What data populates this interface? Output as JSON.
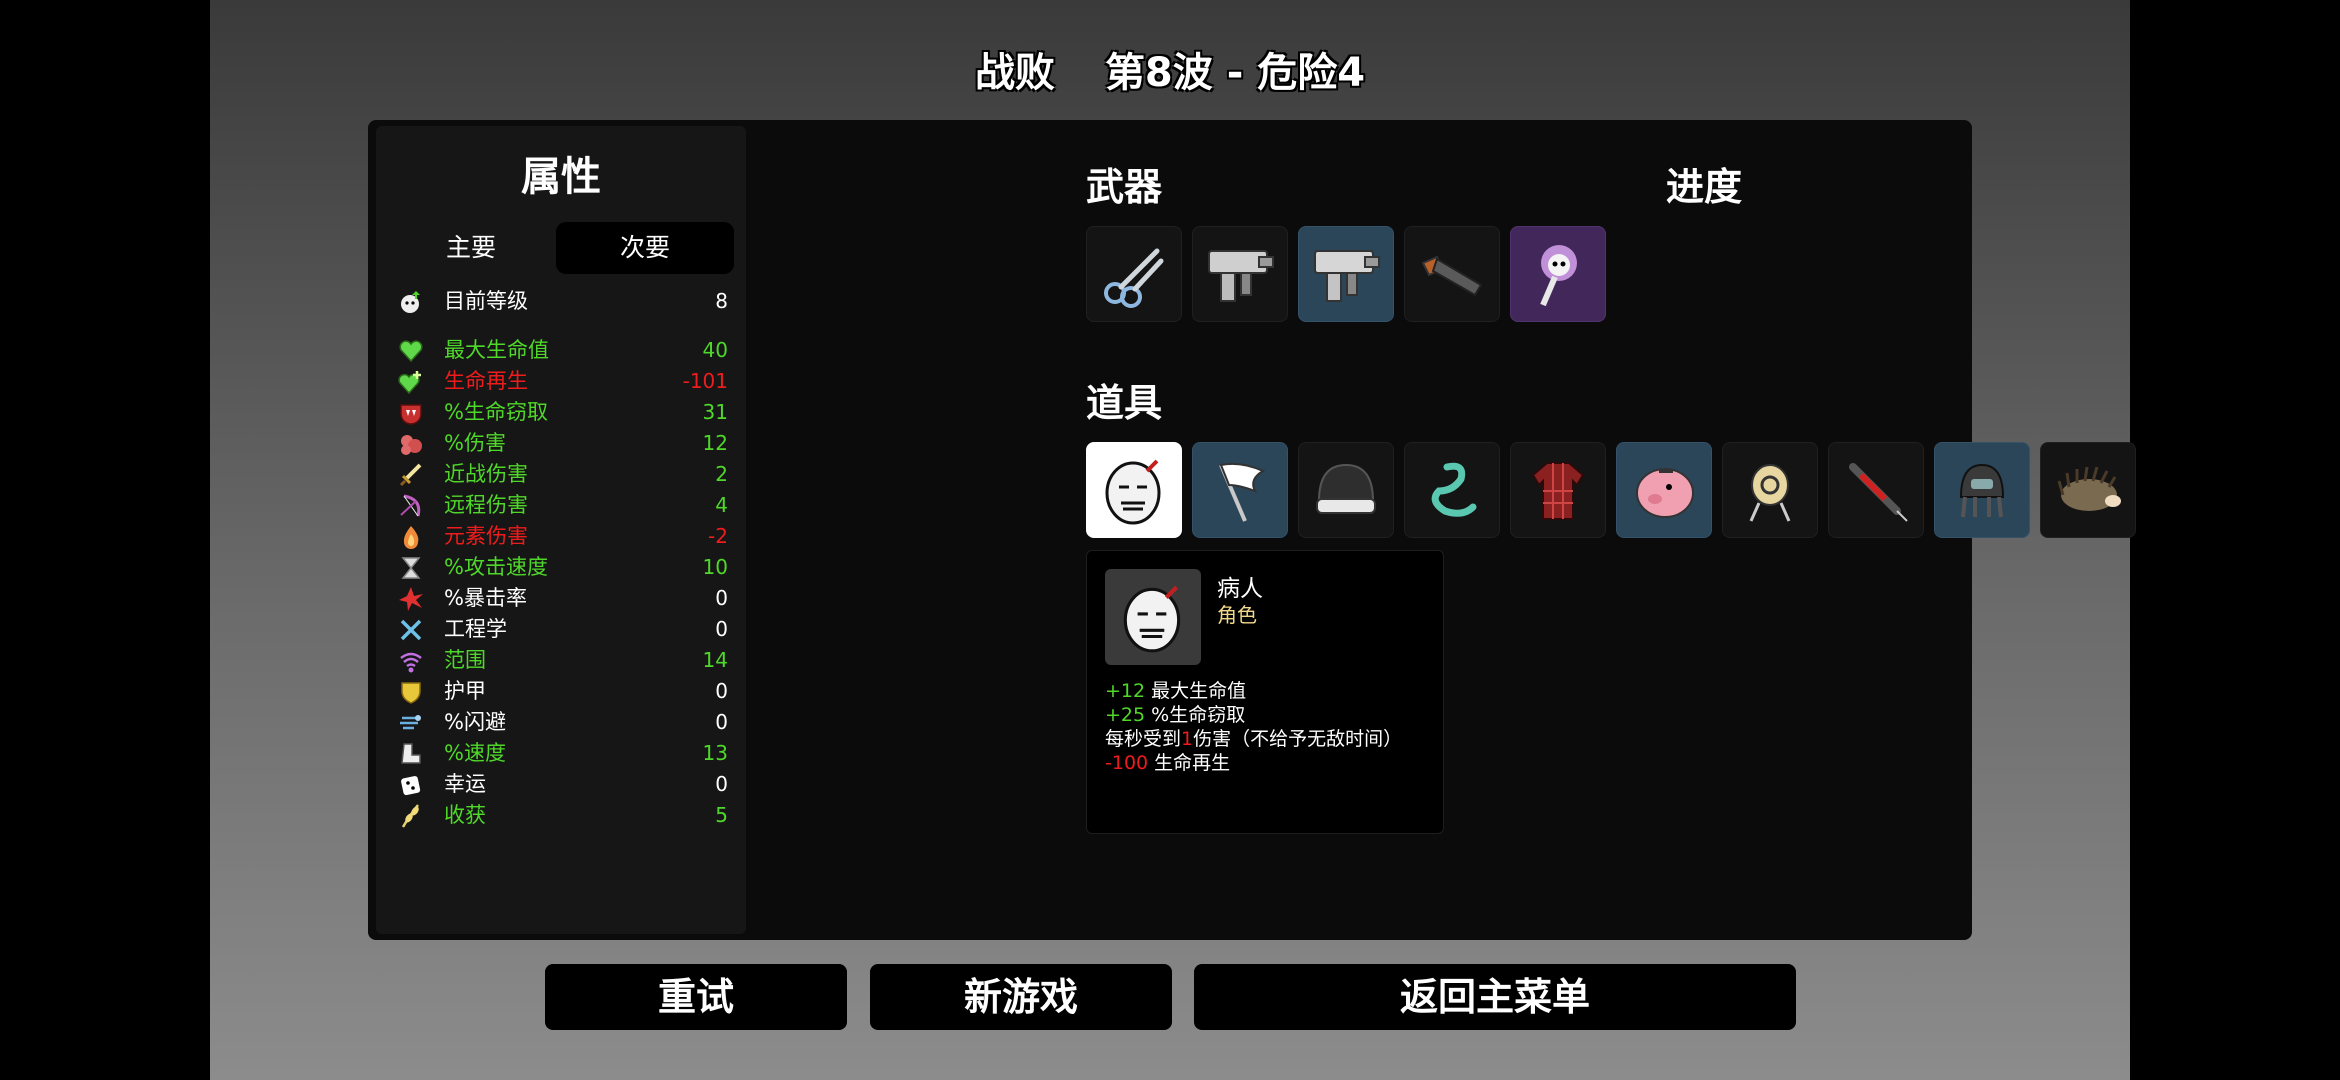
{
  "header": {
    "result": "战败",
    "wave_info": "第8波 - 危险4"
  },
  "stats_panel": {
    "title": "属性",
    "tabs": [
      {
        "label": "主要",
        "active": false
      },
      {
        "label": "次要",
        "active": true
      }
    ],
    "rows": [
      {
        "icon": "level-icon",
        "label": "目前等级",
        "value": "8",
        "color": "#ffffff"
      },
      {
        "icon": "heart-icon",
        "label": "最大生命值",
        "value": "40",
        "color": "#4fd82a"
      },
      {
        "icon": "regen-heart-icon",
        "label": "生命再生",
        "value": "-101",
        "color": "#ee1c1c"
      },
      {
        "icon": "vampire-icon",
        "label": "%生命窃取",
        "value": "31",
        "color": "#4fd82a"
      },
      {
        "icon": "muscle-icon",
        "label": "%伤害",
        "value": "12",
        "color": "#4fd82a"
      },
      {
        "icon": "sword-icon",
        "label": "近战伤害",
        "value": "2",
        "color": "#4fd82a"
      },
      {
        "icon": "bow-icon",
        "label": "远程伤害",
        "value": "4",
        "color": "#4fd82a"
      },
      {
        "icon": "flame-icon",
        "label": "元素伤害",
        "value": "-2",
        "color": "#ee1c1c"
      },
      {
        "icon": "hourglass-icon",
        "label": "%攻击速度",
        "value": "10",
        "color": "#4fd82a"
      },
      {
        "icon": "crit-icon",
        "label": "%暴击率",
        "value": "0",
        "color": "#ffffff"
      },
      {
        "icon": "wrench-icon",
        "label": "工程学",
        "value": "0",
        "color": "#ffffff"
      },
      {
        "icon": "range-icon",
        "label": "范围",
        "value": "14",
        "color": "#4fd82a"
      },
      {
        "icon": "shield-icon",
        "label": "护甲",
        "value": "0",
        "color": "#ffffff"
      },
      {
        "icon": "dodge-icon",
        "label": "%闪避",
        "value": "0",
        "color": "#ffffff"
      },
      {
        "icon": "boot-icon",
        "label": "%速度",
        "value": "13",
        "color": "#4fd82a"
      },
      {
        "icon": "dice-icon",
        "label": "幸运",
        "value": "0",
        "color": "#ffffff"
      },
      {
        "icon": "harvest-icon",
        "label": "收获",
        "value": "5",
        "color": "#4fd82a"
      }
    ]
  },
  "weapons": {
    "title": "武器",
    "items": [
      {
        "name": "scissors-icon",
        "tier": "common"
      },
      {
        "name": "smg-icon",
        "tier": "common"
      },
      {
        "name": "smg-icon",
        "tier": "rare"
      },
      {
        "name": "shotgun-icon",
        "tier": "common"
      },
      {
        "name": "skull-staff-icon",
        "tier": "legendary"
      }
    ]
  },
  "progress": {
    "title": "进度"
  },
  "items": {
    "title": "道具",
    "list": [
      {
        "name": "sick-egg-icon",
        "tier": "selected"
      },
      {
        "name": "white-flag-icon",
        "tier": "rare"
      },
      {
        "name": "beanie-icon",
        "tier": "common"
      },
      {
        "name": "tentacle-icon",
        "tier": "common"
      },
      {
        "name": "plaid-shirt-icon",
        "tier": "common"
      },
      {
        "name": "piggy-bank-icon",
        "tier": "rare"
      },
      {
        "name": "target-dummy-icon",
        "tier": "common"
      },
      {
        "name": "syringe-icon",
        "tier": "common"
      },
      {
        "name": "diving-helmet-icon",
        "tier": "rare"
      },
      {
        "name": "hedgehog-icon",
        "tier": "common"
      }
    ]
  },
  "tooltip": {
    "name": "病人",
    "type": "角色",
    "effects": [
      {
        "prefix": "+12",
        "prefix_color": "#4fd82a",
        "text": " 最大生命值"
      },
      {
        "prefix": "+25",
        "prefix_color": "#4fd82a",
        "text": " %生命窃取"
      },
      {
        "pre": "每秒受到",
        "highlight": "1",
        "post": "伤害（不给予无敌时间）"
      },
      {
        "prefix": "-100",
        "prefix_color": "#ee1c1c",
        "text": " 生命再生"
      }
    ]
  },
  "buttons": {
    "retry": "重试",
    "new_game": "新游戏",
    "main_menu": "返回主菜单"
  },
  "colors": {
    "positive": "#4fd82a",
    "negative": "#ee1c1c",
    "rare_slot": "#2b4559",
    "legendary_slot": "#42285a"
  }
}
